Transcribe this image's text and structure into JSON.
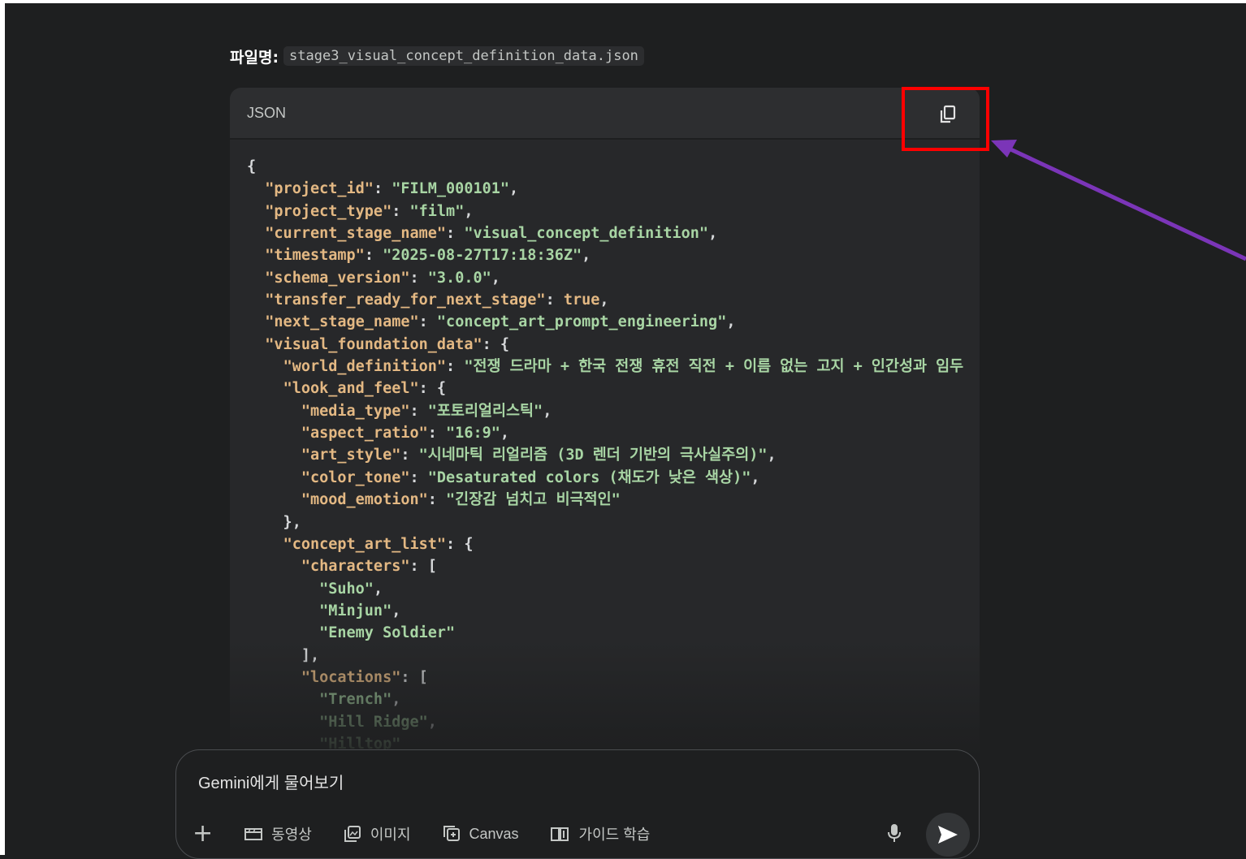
{
  "file": {
    "label": "파일명:",
    "name": "stage3_visual_concept_definition_data.json"
  },
  "code_block": {
    "language": "JSON",
    "copy_icon": "copy-icon",
    "lines": [
      [
        {
          "t": "p",
          "v": "{"
        }
      ],
      [
        {
          "t": "p",
          "v": "  "
        },
        {
          "t": "k",
          "v": "\"project_id\""
        },
        {
          "t": "p",
          "v": ": "
        },
        {
          "t": "s",
          "v": "\"FILM_000101\""
        },
        {
          "t": "p",
          "v": ","
        }
      ],
      [
        {
          "t": "p",
          "v": "  "
        },
        {
          "t": "k",
          "v": "\"project_type\""
        },
        {
          "t": "p",
          "v": ": "
        },
        {
          "t": "s",
          "v": "\"film\""
        },
        {
          "t": "p",
          "v": ","
        }
      ],
      [
        {
          "t": "p",
          "v": "  "
        },
        {
          "t": "k",
          "v": "\"current_stage_name\""
        },
        {
          "t": "p",
          "v": ": "
        },
        {
          "t": "s",
          "v": "\"visual_concept_definition\""
        },
        {
          "t": "p",
          "v": ","
        }
      ],
      [
        {
          "t": "p",
          "v": "  "
        },
        {
          "t": "k",
          "v": "\"timestamp\""
        },
        {
          "t": "p",
          "v": ": "
        },
        {
          "t": "s",
          "v": "\"2025-08-27T17:18:36Z\""
        },
        {
          "t": "p",
          "v": ","
        }
      ],
      [
        {
          "t": "p",
          "v": "  "
        },
        {
          "t": "k",
          "v": "\"schema_version\""
        },
        {
          "t": "p",
          "v": ": "
        },
        {
          "t": "s",
          "v": "\"3.0.0\""
        },
        {
          "t": "p",
          "v": ","
        }
      ],
      [
        {
          "t": "p",
          "v": "  "
        },
        {
          "t": "k",
          "v": "\"transfer_ready_for_next_stage\""
        },
        {
          "t": "p",
          "v": ": "
        },
        {
          "t": "b",
          "v": "true"
        },
        {
          "t": "p",
          "v": ","
        }
      ],
      [
        {
          "t": "p",
          "v": "  "
        },
        {
          "t": "k",
          "v": "\"next_stage_name\""
        },
        {
          "t": "p",
          "v": ": "
        },
        {
          "t": "s",
          "v": "\"concept_art_prompt_engineering\""
        },
        {
          "t": "p",
          "v": ","
        }
      ],
      [
        {
          "t": "p",
          "v": "  "
        },
        {
          "t": "k",
          "v": "\"visual_foundation_data\""
        },
        {
          "t": "p",
          "v": ": {"
        }
      ],
      [
        {
          "t": "p",
          "v": "    "
        },
        {
          "t": "k",
          "v": "\"world_definition\""
        },
        {
          "t": "p",
          "v": ": "
        },
        {
          "t": "s",
          "v": "\"전쟁 드라마 + 한국 전쟁 휴전 직전 + 이름 없는 고지 + 인간성과 임두"
        }
      ],
      [
        {
          "t": "p",
          "v": "    "
        },
        {
          "t": "k",
          "v": "\"look_and_feel\""
        },
        {
          "t": "p",
          "v": ": {"
        }
      ],
      [
        {
          "t": "p",
          "v": "      "
        },
        {
          "t": "k",
          "v": "\"media_type\""
        },
        {
          "t": "p",
          "v": ": "
        },
        {
          "t": "s",
          "v": "\"포토리얼리스틱\""
        },
        {
          "t": "p",
          "v": ","
        }
      ],
      [
        {
          "t": "p",
          "v": "      "
        },
        {
          "t": "k",
          "v": "\"aspect_ratio\""
        },
        {
          "t": "p",
          "v": ": "
        },
        {
          "t": "s",
          "v": "\"16:9\""
        },
        {
          "t": "p",
          "v": ","
        }
      ],
      [
        {
          "t": "p",
          "v": "      "
        },
        {
          "t": "k",
          "v": "\"art_style\""
        },
        {
          "t": "p",
          "v": ": "
        },
        {
          "t": "s",
          "v": "\"시네마틱 리얼리즘 (3D 렌더 기반의 극사실주의)\""
        },
        {
          "t": "p",
          "v": ","
        }
      ],
      [
        {
          "t": "p",
          "v": "      "
        },
        {
          "t": "k",
          "v": "\"color_tone\""
        },
        {
          "t": "p",
          "v": ": "
        },
        {
          "t": "s",
          "v": "\"Desaturated colors (채도가 낮은 색상)\""
        },
        {
          "t": "p",
          "v": ","
        }
      ],
      [
        {
          "t": "p",
          "v": "      "
        },
        {
          "t": "k",
          "v": "\"mood_emotion\""
        },
        {
          "t": "p",
          "v": ": "
        },
        {
          "t": "s",
          "v": "\"긴장감 넘치고 비극적인\""
        }
      ],
      [
        {
          "t": "p",
          "v": "    },"
        }
      ],
      [
        {
          "t": "p",
          "v": "    "
        },
        {
          "t": "k",
          "v": "\"concept_art_list\""
        },
        {
          "t": "p",
          "v": ": {"
        }
      ],
      [
        {
          "t": "p",
          "v": "      "
        },
        {
          "t": "k",
          "v": "\"characters\""
        },
        {
          "t": "p",
          "v": ": ["
        }
      ],
      [
        {
          "t": "p",
          "v": "        "
        },
        {
          "t": "s",
          "v": "\"Suho\""
        },
        {
          "t": "p",
          "v": ","
        }
      ],
      [
        {
          "t": "p",
          "v": "        "
        },
        {
          "t": "s",
          "v": "\"Minjun\""
        },
        {
          "t": "p",
          "v": ","
        }
      ],
      [
        {
          "t": "p",
          "v": "        "
        },
        {
          "t": "s",
          "v": "\"Enemy Soldier\""
        }
      ],
      [
        {
          "t": "p",
          "v": "      ],"
        }
      ],
      [
        {
          "t": "p",
          "v": "      "
        },
        {
          "t": "k",
          "v": "\"locations\""
        },
        {
          "t": "p",
          "v": ": ["
        }
      ],
      [
        {
          "t": "p",
          "v": "        "
        },
        {
          "t": "s",
          "v": "\"Trench\""
        },
        {
          "t": "p",
          "v": ","
        }
      ],
      [
        {
          "t": "p",
          "v": "        "
        },
        {
          "t": "s",
          "v": "\"Hill Ridge\""
        },
        {
          "t": "p",
          "v": ","
        }
      ],
      [
        {
          "t": "p",
          "v": "        "
        },
        {
          "t": "s",
          "v": "\"Hilltop\""
        }
      ]
    ]
  },
  "annotation": {
    "highlight_color": "#ff0000",
    "arrow_color": "#7b35b8"
  },
  "input": {
    "placeholder": "Gemini에게 물어보기",
    "tools": [
      {
        "name": "video",
        "label": "동영상",
        "icon": "video-icon"
      },
      {
        "name": "image",
        "label": "이미지",
        "icon": "image-icon"
      },
      {
        "name": "canvas",
        "label": "Canvas",
        "icon": "canvas-icon"
      },
      {
        "name": "guided-learning",
        "label": "가이드 학습",
        "icon": "book-icon"
      }
    ],
    "plus_icon": "plus-icon",
    "mic_icon": "mic-icon",
    "send_icon": "send-icon"
  }
}
